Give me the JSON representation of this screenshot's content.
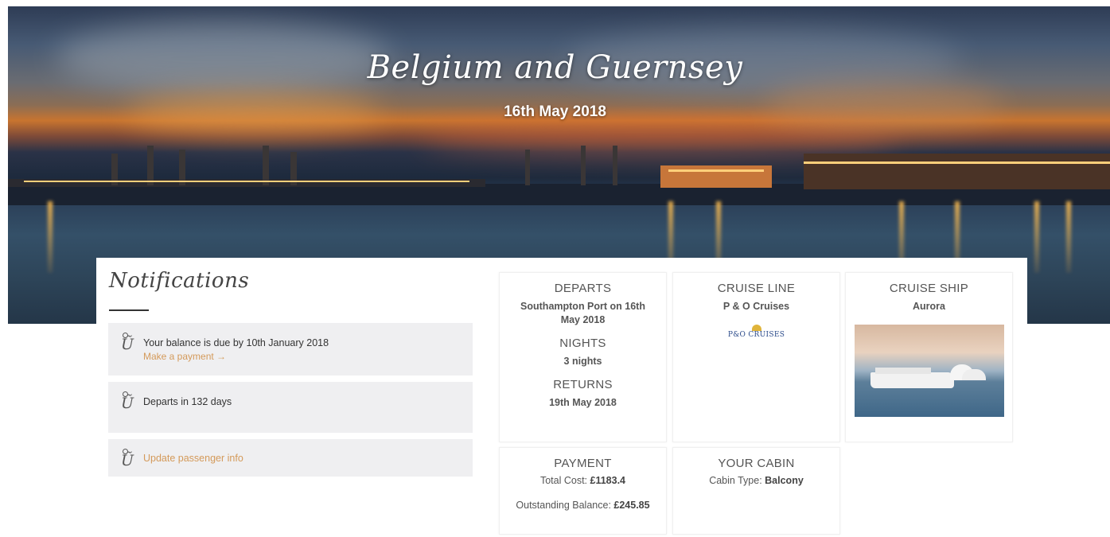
{
  "hero": {
    "title": "Belgium and Guernsey",
    "date": "16th May 2018"
  },
  "notifications": {
    "heading": "Notifications",
    "items": [
      {
        "text": "Your balance is due by 10th January 2018",
        "link": "Make a payment →",
        "icon": "info-icon"
      },
      {
        "text": "Departs in 132 days",
        "icon": "info-icon"
      },
      {
        "link": "Update passenger info",
        "icon": "info-icon"
      }
    ]
  },
  "trip": {
    "departs": {
      "label": "DEPARTS",
      "value": "Southampton Port on 16th May 2018"
    },
    "nights": {
      "label": "NIGHTS",
      "value": "3 nights"
    },
    "returns": {
      "label": "RETURNS",
      "value": "19th May 2018"
    },
    "cruise_line": {
      "label": "CRUISE LINE",
      "value": "P & O Cruises",
      "logo_text": "P&O CRUISES"
    },
    "cruise_ship": {
      "label": "CRUISE SHIP",
      "value": "Aurora"
    },
    "payment": {
      "label": "PAYMENT",
      "total_label": "Total Cost:",
      "total_value": "£1183.4",
      "outstanding_label": "Outstanding Balance:",
      "outstanding_value": "£245.85"
    },
    "cabin": {
      "label": "YOUR CABIN",
      "type_label": "Cabin Type:",
      "type_value": "Balcony"
    }
  },
  "colors": {
    "link": "#d49a5a",
    "panel": "#efeff1"
  }
}
